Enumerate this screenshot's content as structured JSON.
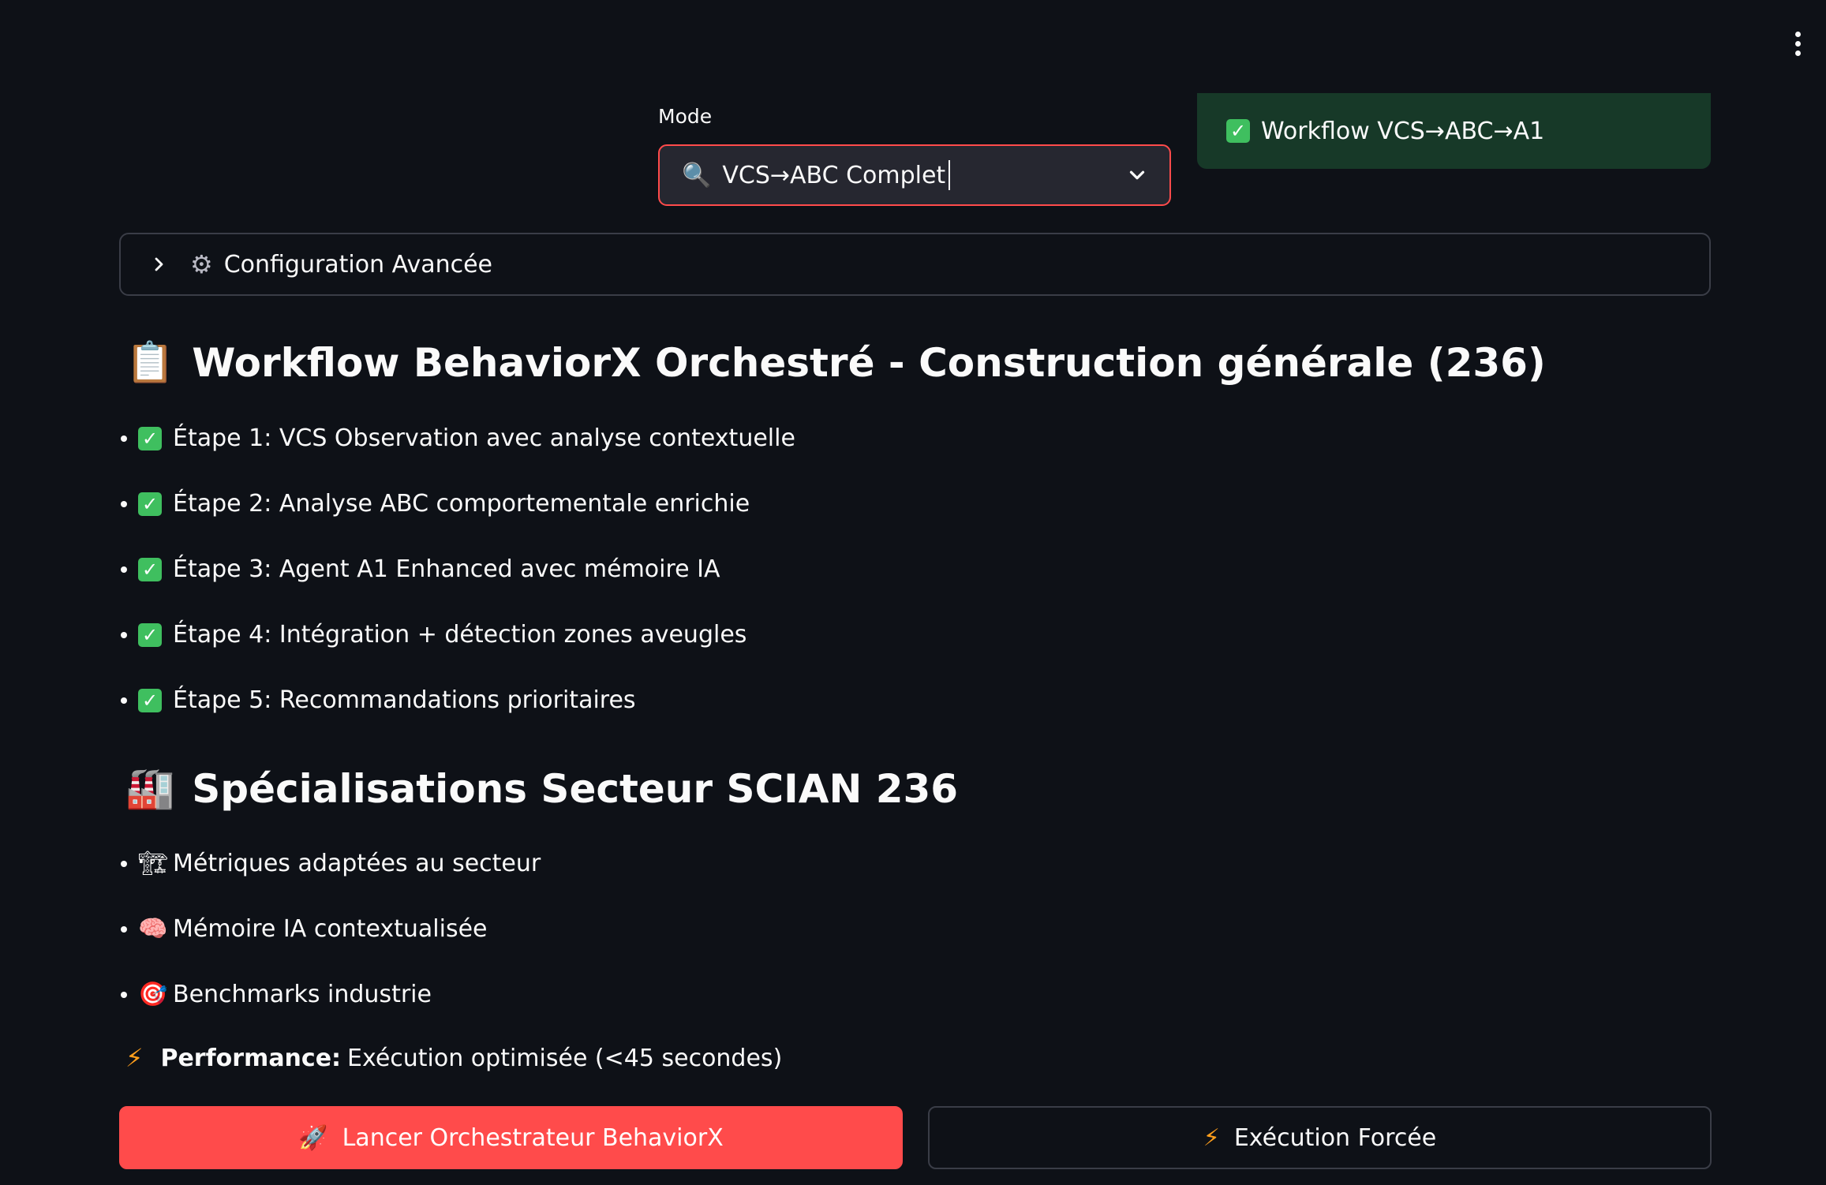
{
  "mode": {
    "label": "Mode",
    "selected": "VCS→ABC Complet",
    "icon": "magnifier-icon"
  },
  "status": {
    "message": "Workflow VCS→ABC→A1",
    "color": "#173928"
  },
  "expander": {
    "label": "Configuration Avancée",
    "icon": "gear-icon"
  },
  "workflow": {
    "title": "Workflow BehaviorX Orchestré - Construction générale (236)",
    "icon": "clipboard-icon",
    "steps": [
      "Étape 1: VCS Observation avec analyse contextuelle",
      "Étape 2: Analyse ABC comportementale enrichie",
      "Étape 3: Agent A1 Enhanced avec mémoire IA",
      "Étape 4: Intégration + détection zones aveugles",
      "Étape 5: Recommandations prioritaires"
    ]
  },
  "sector": {
    "title": "Spécialisations Secteur SCIAN 236",
    "icon": "factory-icon",
    "items": [
      {
        "text": "Métriques adaptées au secteur",
        "icon": "construction-crane-icon"
      },
      {
        "text": "Mémoire IA contextualisée",
        "icon": "brain-icon"
      },
      {
        "text": "Benchmarks industrie",
        "icon": "target-icon"
      }
    ]
  },
  "performance": {
    "label": "Performance:",
    "text": "Exécution optimisée (<45 secondes)"
  },
  "buttons": {
    "launch": "Lancer Orchestrateur BehaviorX",
    "force": "Exécution Forcée"
  },
  "colors": {
    "accent": "#ff4b4b",
    "background": "#0e1117",
    "success": "#3fbf5f",
    "bolt": "#ff9f1c"
  }
}
